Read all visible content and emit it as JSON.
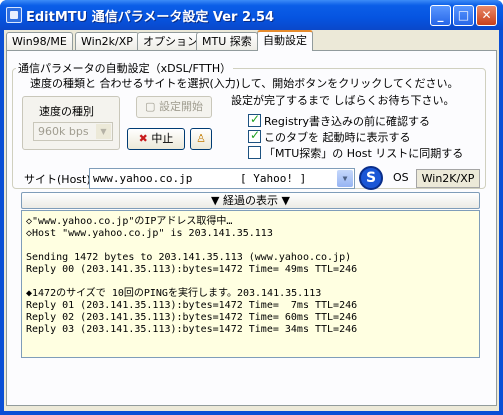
{
  "window": {
    "title": "EditMTU  通信パラメータ設定 Ver 2.54",
    "minimize_glyph": "_",
    "maximize_glyph": "□",
    "close_glyph": "✕"
  },
  "tabs": [
    {
      "label": "Win98/ME"
    },
    {
      "label": "Win2k/XP"
    },
    {
      "label": "オプション"
    },
    {
      "label": "MTU 探索"
    },
    {
      "label": "自動設定"
    }
  ],
  "auto_config": {
    "group_title": "通信パラメータの自動設定（xDSL/FTTH）",
    "instruction": "速度の種類と 合わせるサイトを選択(入力)して、開始ボタンをクリックしてください。",
    "wait_message": "設定が完了するまで しばらくお待ち下さい。",
    "speed_label": "速度の種別",
    "speed_value": "960k bps",
    "start_button": "設定開始",
    "stop_button": "中止",
    "checkboxes": [
      {
        "label": "Registry書き込みの前に確認する",
        "checked": true
      },
      {
        "label": "このタブを 起動時に表示する",
        "checked": true
      },
      {
        "label": "「MTU探索」の Host リストに同期する",
        "checked": false
      }
    ]
  },
  "host": {
    "label": "サイト(Host)",
    "value": "www.yahoo.co.jp",
    "site_name": "[ Yahoo! ]",
    "os_label": "OS",
    "os_value": "Win2K/XP"
  },
  "progress": {
    "header": "▼ 経過の表示 ▼",
    "lines": [
      "◇\"www.yahoo.co.jp\"のIPアドレス取得中…",
      "◇Host \"www.yahoo.co.jp\" is 203.141.35.113",
      "",
      "Sending 1472 bytes to 203.141.35.113 (www.yahoo.co.jp)",
      "Reply 00 (203.141.35.113):bytes=1472 Time= 49ms TTL=246",
      "",
      "◆1472のサイズで 10回のPINGを実行します。203.141.35.113",
      "Reply 01 (203.141.35.113):bytes=1472 Time=  7ms TTL=246",
      "Reply 02 (203.141.35.113):bytes=1472 Time= 60ms TTL=246",
      "Reply 03 (203.141.35.113):bytes=1472 Time= 34ms TTL=246"
    ]
  },
  "colors": {
    "titlebar": "#0a4fd6",
    "panel": "#ece9d8",
    "log_background": "#ffffe1",
    "tab_highlight": "#e68b2c"
  }
}
